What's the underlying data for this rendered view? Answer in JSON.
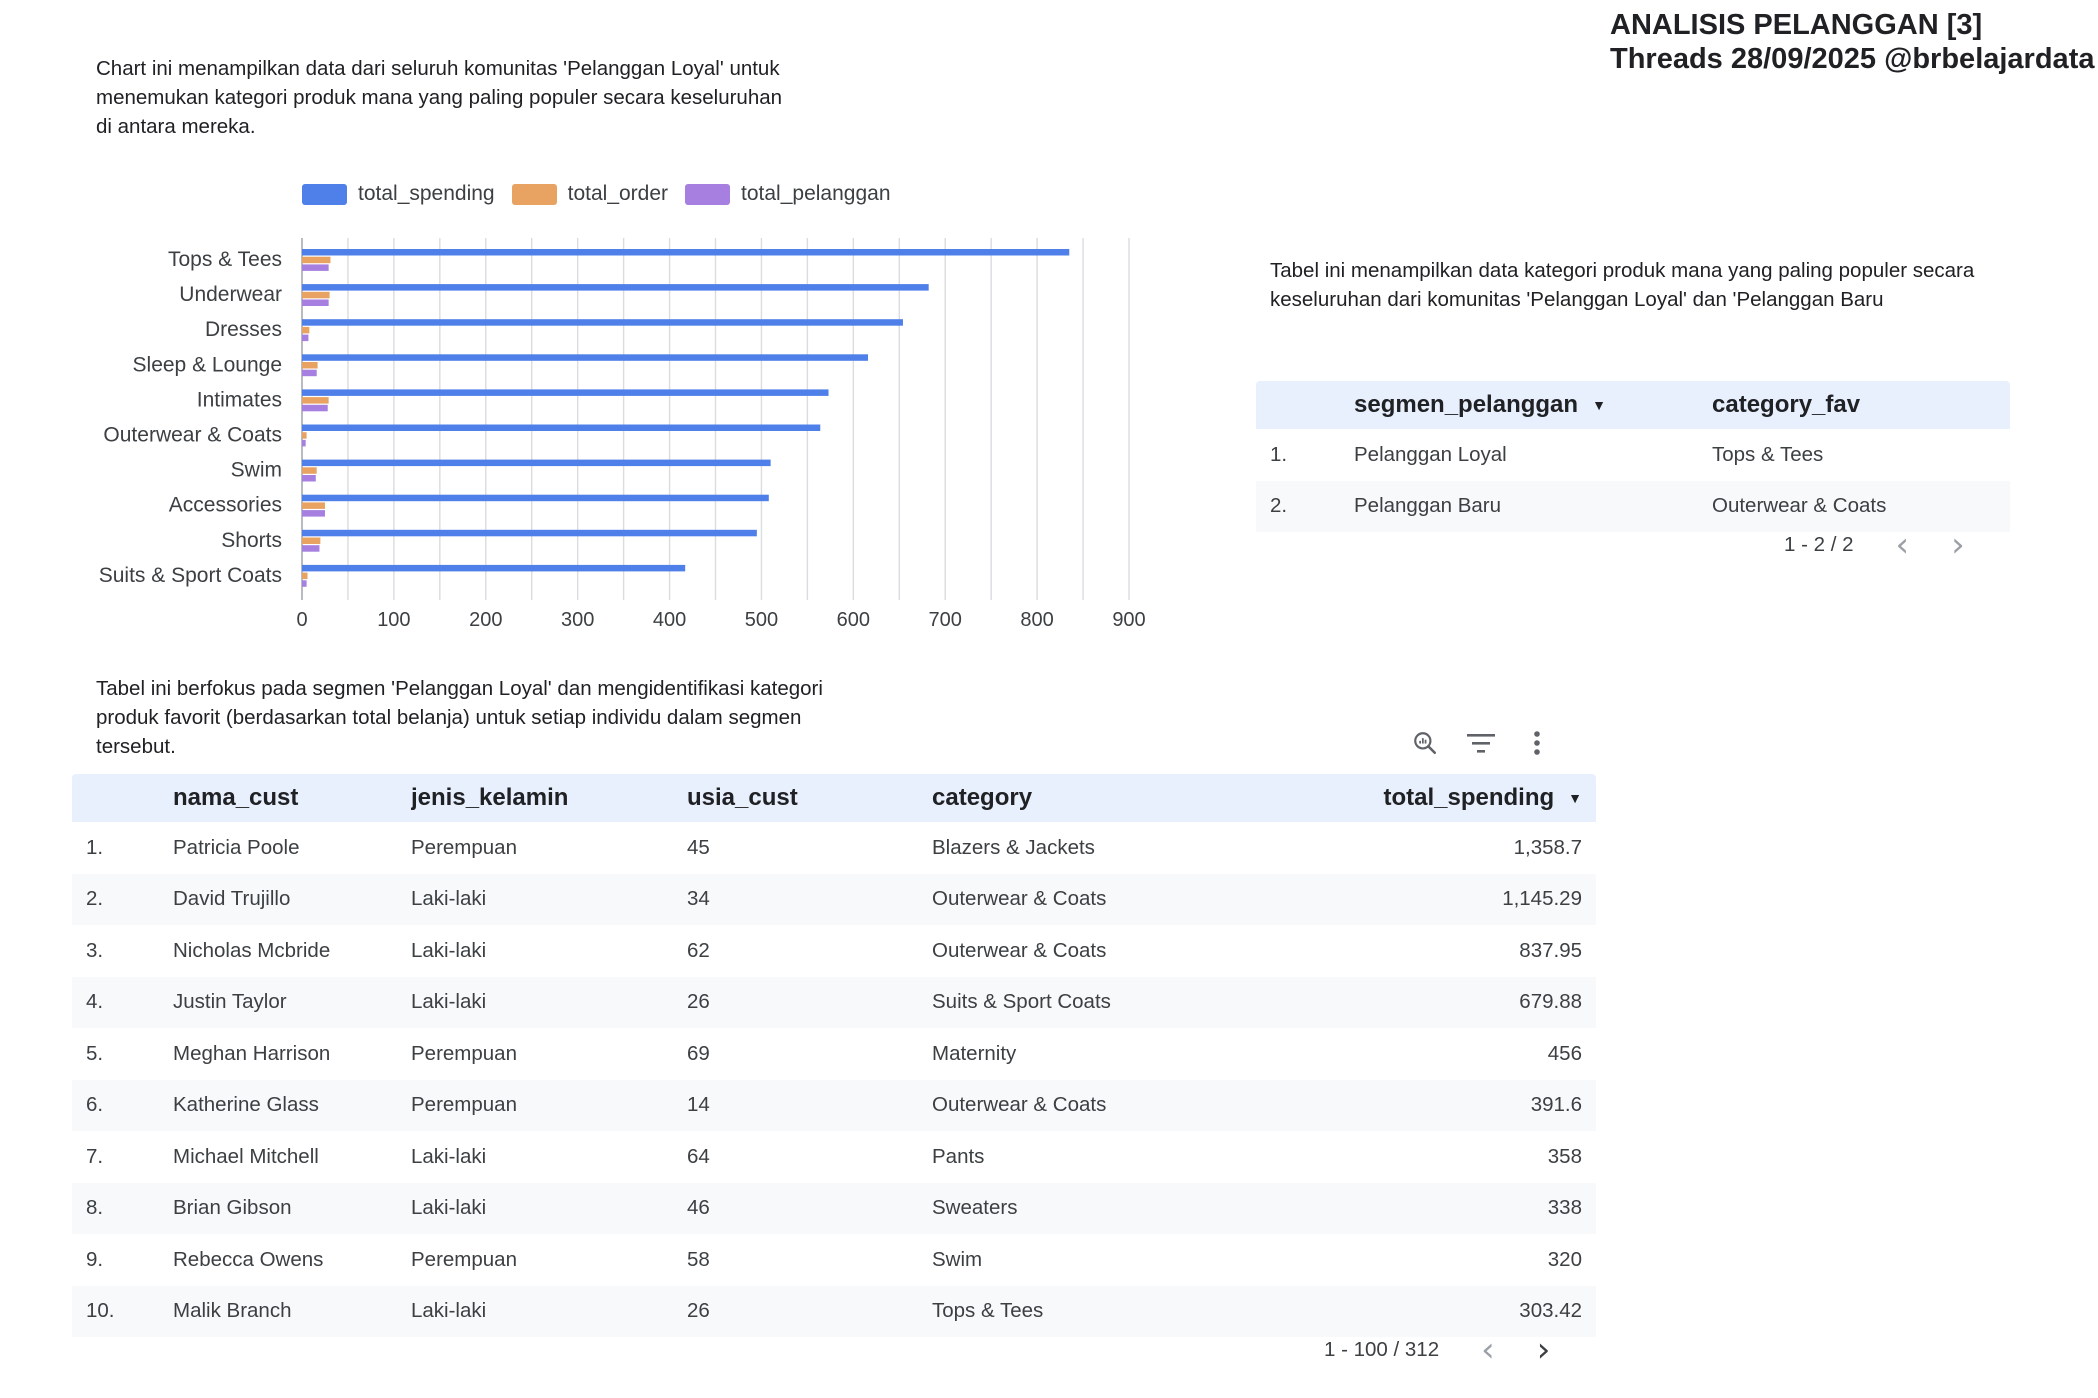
{
  "header": {
    "line1": "ANALISIS PELANGGAN [3]",
    "line2": "Threads 28/09/2025 @brbelajardata"
  },
  "descriptions": {
    "chart": "Chart ini menampilkan data dari seluruh komunitas 'Pelanggan Loyal' untuk menemukan kategori produk mana yang paling populer secara keseluruhan di antara mereka.",
    "segment_table": "Tabel ini menampilkan data kategori produk mana yang paling populer secara keseluruhan dari komunitas 'Pelanggan Loyal' dan 'Pelanggan Baru",
    "loyal_table": "Tabel ini berfokus pada segmen 'Pelanggan Loyal' dan mengidentifikasi kategori produk favorit (berdasarkan total belanja) untuk setiap individu dalam segmen tersebut."
  },
  "chart_data": {
    "type": "bar",
    "orientation": "horizontal",
    "categories": [
      "Tops & Tees",
      "Underwear",
      "Dresses",
      "Sleep & Lounge",
      "Intimates",
      "Outerwear & Coats",
      "Swim",
      "Accessories",
      "Shorts",
      "Suits & Sport Coats"
    ],
    "series": [
      {
        "name": "total_spending",
        "values": [
          835,
          682,
          654,
          616,
          573,
          564,
          510,
          508,
          495,
          417
        ],
        "color": "#4f7fe8"
      },
      {
        "name": "total_order",
        "values": [
          31,
          30,
          8,
          17,
          29,
          5,
          16,
          25,
          20,
          6
        ],
        "color": "#e8a363"
      },
      {
        "name": "total_pelanggan",
        "values": [
          29,
          29,
          7,
          16,
          28,
          4,
          15,
          25,
          19,
          5
        ],
        "color": "#a67fe0"
      }
    ],
    "xticks": [
      "0",
      "100",
      "200",
      "300",
      "400",
      "500",
      "600",
      "700",
      "800",
      "900"
    ],
    "xlim": [
      0,
      900
    ],
    "grid": true,
    "legend_position": "top"
  },
  "segment_table": {
    "columns": {
      "segment": "segmen_pelanggan",
      "category": "category_fav"
    },
    "rows": [
      {
        "idx": "1.",
        "segment": "Pelanggan Loyal",
        "category": "Tops & Tees"
      },
      {
        "idx": "2.",
        "segment": "Pelanggan Baru",
        "category": "Outerwear & Coats"
      }
    ],
    "pager": "1 - 2 / 2",
    "sort_indicator": "▼"
  },
  "loyal_table": {
    "columns": {
      "name": "nama_cust",
      "sex": "jenis_kelamin",
      "age": "usia_cust",
      "category": "category",
      "spending": "total_spending"
    },
    "rows": [
      {
        "idx": "1.",
        "name": "Patricia Poole",
        "sex": "Perempuan",
        "age": "45",
        "category": "Blazers & Jackets",
        "spending": "1,358.7"
      },
      {
        "idx": "2.",
        "name": "David Trujillo",
        "sex": "Laki-laki",
        "age": "34",
        "category": "Outerwear & Coats",
        "spending": "1,145.29"
      },
      {
        "idx": "3.",
        "name": "Nicholas Mcbride",
        "sex": "Laki-laki",
        "age": "62",
        "category": "Outerwear & Coats",
        "spending": "837.95"
      },
      {
        "idx": "4.",
        "name": "Justin Taylor",
        "sex": "Laki-laki",
        "age": "26",
        "category": "Suits & Sport Coats",
        "spending": "679.88"
      },
      {
        "idx": "5.",
        "name": "Meghan Harrison",
        "sex": "Perempuan",
        "age": "69",
        "category": "Maternity",
        "spending": "456"
      },
      {
        "idx": "6.",
        "name": "Katherine Glass",
        "sex": "Perempuan",
        "age": "14",
        "category": "Outerwear & Coats",
        "spending": "391.6"
      },
      {
        "idx": "7.",
        "name": "Michael Mitchell",
        "sex": "Laki-laki",
        "age": "64",
        "category": "Pants",
        "spending": "358"
      },
      {
        "idx": "8.",
        "name": "Brian Gibson",
        "sex": "Laki-laki",
        "age": "46",
        "category": "Sweaters",
        "spending": "338"
      },
      {
        "idx": "9.",
        "name": "Rebecca Owens",
        "sex": "Perempuan",
        "age": "58",
        "category": "Swim",
        "spending": "320"
      },
      {
        "idx": "10.",
        "name": "Malik Branch",
        "sex": "Laki-laki",
        "age": "26",
        "category": "Tops & Tees",
        "spending": "303.42"
      }
    ],
    "pager": "1 - 100 / 312",
    "sort_indicator": "▼",
    "toolbar_icons": [
      "zoom-insights-icon",
      "filter-icon",
      "more-vert-icon"
    ]
  },
  "pager_icons": {
    "prev": "‹",
    "next": "›"
  }
}
